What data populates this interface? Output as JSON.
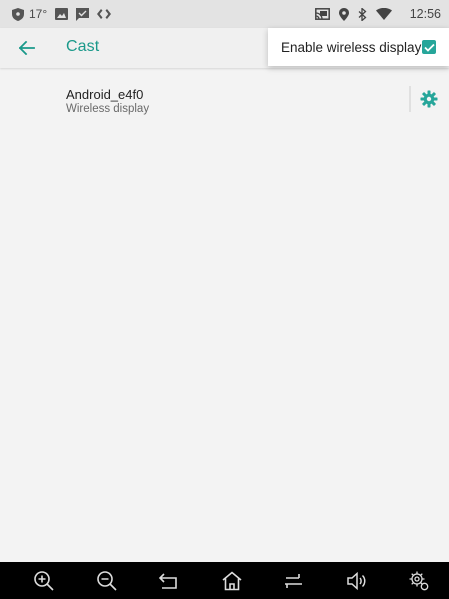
{
  "status_bar": {
    "temperature": "17°",
    "time": "12:56",
    "left_icons": [
      "shield-icon",
      "image-icon",
      "message-icon",
      "code-icon"
    ],
    "right_icons": [
      "cast-icon",
      "location-icon",
      "bluetooth-icon",
      "wifi-icon"
    ]
  },
  "app_bar": {
    "title": "Cast",
    "back_icon": "arrow-left-icon"
  },
  "menu": {
    "enable_wireless_label": "Enable wireless display",
    "enable_wireless_checked": true
  },
  "devices": [
    {
      "name": "Android_e4f0",
      "subtitle": "Wireless display",
      "settings_icon": "gear-icon"
    }
  ],
  "nav_bar": {
    "buttons": [
      "zoom-in-icon",
      "zoom-out-icon",
      "back-icon",
      "home-icon",
      "recents-icon",
      "volume-icon",
      "settings-icon"
    ]
  },
  "colors": {
    "accent": "#1a998a",
    "checkbox": "#26a69a",
    "background": "#f3f3f3",
    "status_bar": "#e3e3e3",
    "nav_bar": "#000000"
  }
}
